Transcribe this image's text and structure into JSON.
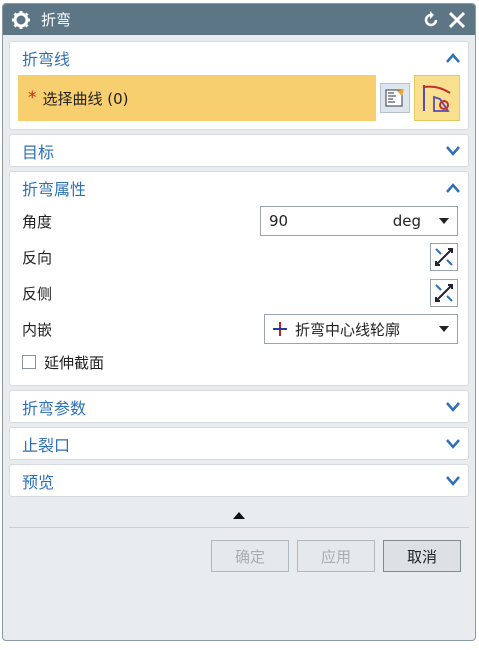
{
  "window": {
    "title": "折弯"
  },
  "sections": {
    "bend_line": {
      "label": "折弯线",
      "select_curve": "选择曲线 (0)",
      "required_mark": "*"
    },
    "target": {
      "label": "目标"
    },
    "bend_props": {
      "label": "折弯属性",
      "angle_label": "角度",
      "angle_value": "90",
      "angle_unit": "deg",
      "reverse_label": "反向",
      "flip_side_label": "反侧",
      "inset_label": "内嵌",
      "inset_value": "折弯中心线轮廓",
      "extend_label": "延伸截面"
    },
    "bend_params": {
      "label": "折弯参数"
    },
    "relief": {
      "label": "止裂口"
    },
    "preview": {
      "label": "预览"
    }
  },
  "buttons": {
    "ok": "确定",
    "apply": "应用",
    "cancel": "取消"
  },
  "colors": {
    "titlebar": "#5d7685",
    "accent": "#2c70b8",
    "selection": "#f8cf6f"
  }
}
